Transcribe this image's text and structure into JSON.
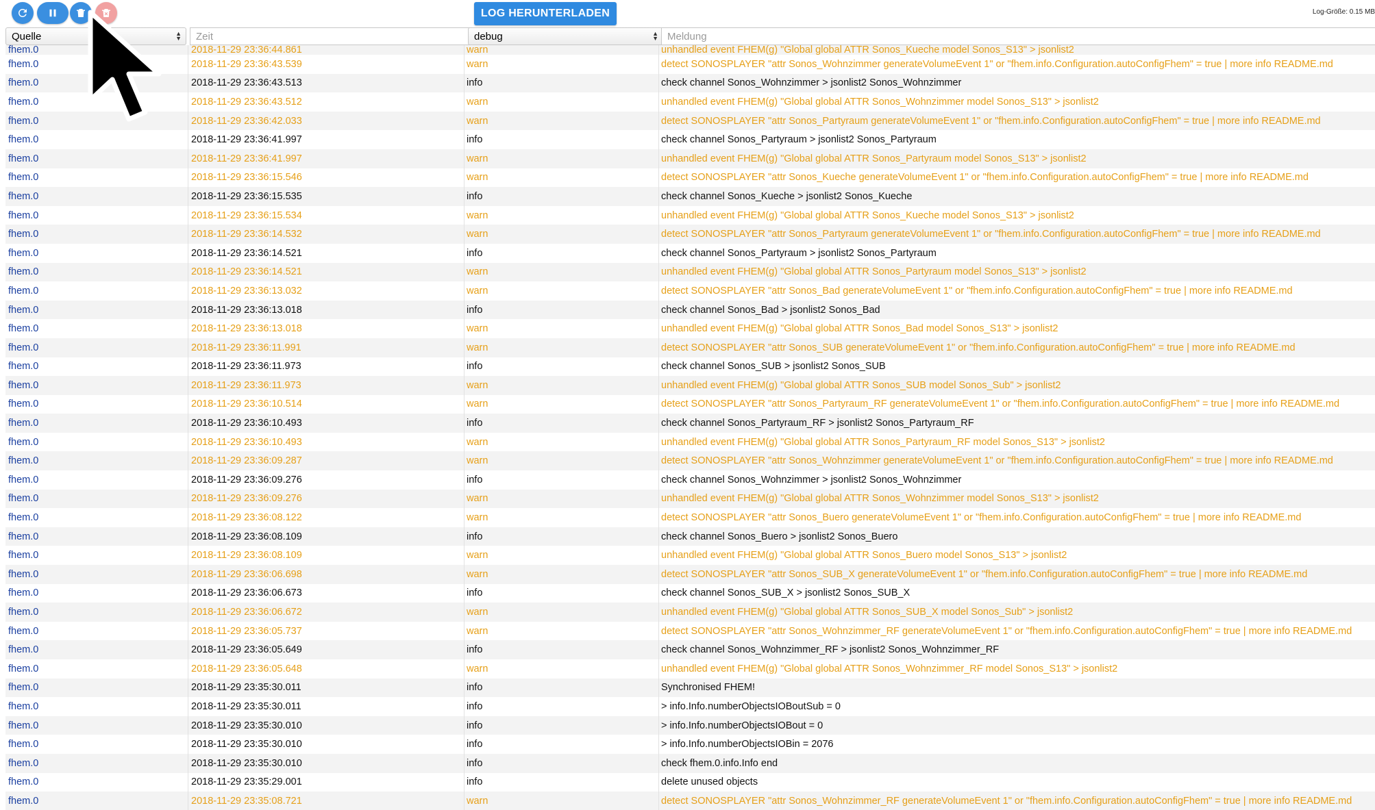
{
  "toolbar": {
    "buttons": [
      {
        "name": "refresh-button",
        "icon": "refresh-icon"
      },
      {
        "name": "pause-button",
        "icon": "pause-icon"
      },
      {
        "name": "clear-button",
        "icon": "trash-icon"
      },
      {
        "name": "delete-button",
        "icon": "delete-icon"
      }
    ],
    "download_label": "LOG HERUNTERLADEN",
    "logsize": "Log-Größe: 0.15 MB"
  },
  "filters": {
    "source": "Quelle",
    "time_placeholder": "Zeit",
    "severity": "debug",
    "message_placeholder": "Meldung"
  },
  "colors": {
    "accent": "#2f8ae0",
    "warn": "#e6a019",
    "source": "#1a3fa0",
    "disabled": "#f1a1a1"
  },
  "top_partial": {
    "source": "fhem.0",
    "time": "2018-11-29 23:36:44.861",
    "severity": "warn",
    "message": "unhandled event FHEM(g) \"Global global ATTR Sonos_Kueche model Sonos_S13\" > jsonlist2"
  },
  "rows": [
    {
      "source": "fhem.0",
      "time": "2018-11-29 23:36:43.539",
      "severity": "warn",
      "message": "detect SONOSPLAYER \"attr Sonos_Wohnzimmer generateVolumeEvent 1\" or \"fhem.info.Configuration.autoConfigFhem\" = true | more info README.md"
    },
    {
      "source": "fhem.0",
      "time": "2018-11-29 23:36:43.513",
      "severity": "info",
      "message": "check channel Sonos_Wohnzimmer > jsonlist2 Sonos_Wohnzimmer"
    },
    {
      "source": "fhem.0",
      "time": "2018-11-29 23:36:43.512",
      "severity": "warn",
      "message": "unhandled event FHEM(g) \"Global global ATTR Sonos_Wohnzimmer model Sonos_S13\" > jsonlist2"
    },
    {
      "source": "fhem.0",
      "time": "2018-11-29 23:36:42.033",
      "severity": "warn",
      "message": "detect SONOSPLAYER \"attr Sonos_Partyraum generateVolumeEvent 1\" or \"fhem.info.Configuration.autoConfigFhem\" = true | more info README.md"
    },
    {
      "source": "fhem.0",
      "time": "2018-11-29 23:36:41.997",
      "severity": "info",
      "message": "check channel Sonos_Partyraum > jsonlist2 Sonos_Partyraum"
    },
    {
      "source": "fhem.0",
      "time": "2018-11-29 23:36:41.997",
      "severity": "warn",
      "message": "unhandled event FHEM(g) \"Global global ATTR Sonos_Partyraum model Sonos_S13\" > jsonlist2"
    },
    {
      "source": "fhem.0",
      "time": "2018-11-29 23:36:15.546",
      "severity": "warn",
      "message": "detect SONOSPLAYER \"attr Sonos_Kueche generateVolumeEvent 1\" or \"fhem.info.Configuration.autoConfigFhem\" = true | more info README.md"
    },
    {
      "source": "fhem.0",
      "time": "2018-11-29 23:36:15.535",
      "severity": "info",
      "message": "check channel Sonos_Kueche > jsonlist2 Sonos_Kueche"
    },
    {
      "source": "fhem.0",
      "time": "2018-11-29 23:36:15.534",
      "severity": "warn",
      "message": "unhandled event FHEM(g) \"Global global ATTR Sonos_Kueche model Sonos_S13\" > jsonlist2"
    },
    {
      "source": "fhem.0",
      "time": "2018-11-29 23:36:14.532",
      "severity": "warn",
      "message": "detect SONOSPLAYER \"attr Sonos_Partyraum generateVolumeEvent 1\" or \"fhem.info.Configuration.autoConfigFhem\" = true | more info README.md"
    },
    {
      "source": "fhem.0",
      "time": "2018-11-29 23:36:14.521",
      "severity": "info",
      "message": "check channel Sonos_Partyraum > jsonlist2 Sonos_Partyraum"
    },
    {
      "source": "fhem.0",
      "time": "2018-11-29 23:36:14.521",
      "severity": "warn",
      "message": "unhandled event FHEM(g) \"Global global ATTR Sonos_Partyraum model Sonos_S13\" > jsonlist2"
    },
    {
      "source": "fhem.0",
      "time": "2018-11-29 23:36:13.032",
      "severity": "warn",
      "message": "detect SONOSPLAYER \"attr Sonos_Bad generateVolumeEvent 1\" or \"fhem.info.Configuration.autoConfigFhem\" = true | more info README.md"
    },
    {
      "source": "fhem.0",
      "time": "2018-11-29 23:36:13.018",
      "severity": "info",
      "message": "check channel Sonos_Bad > jsonlist2 Sonos_Bad"
    },
    {
      "source": "fhem.0",
      "time": "2018-11-29 23:36:13.018",
      "severity": "warn",
      "message": "unhandled event FHEM(g) \"Global global ATTR Sonos_Bad model Sonos_S13\" > jsonlist2"
    },
    {
      "source": "fhem.0",
      "time": "2018-11-29 23:36:11.991",
      "severity": "warn",
      "message": "detect SONOSPLAYER \"attr Sonos_SUB generateVolumeEvent 1\" or \"fhem.info.Configuration.autoConfigFhem\" = true | more info README.md"
    },
    {
      "source": "fhem.0",
      "time": "2018-11-29 23:36:11.973",
      "severity": "info",
      "message": "check channel Sonos_SUB > jsonlist2 Sonos_SUB"
    },
    {
      "source": "fhem.0",
      "time": "2018-11-29 23:36:11.973",
      "severity": "warn",
      "message": "unhandled event FHEM(g) \"Global global ATTR Sonos_SUB model Sonos_Sub\" > jsonlist2"
    },
    {
      "source": "fhem.0",
      "time": "2018-11-29 23:36:10.514",
      "severity": "warn",
      "message": "detect SONOSPLAYER \"attr Sonos_Partyraum_RF generateVolumeEvent 1\" or \"fhem.info.Configuration.autoConfigFhem\" = true | more info README.md"
    },
    {
      "source": "fhem.0",
      "time": "2018-11-29 23:36:10.493",
      "severity": "info",
      "message": "check channel Sonos_Partyraum_RF > jsonlist2 Sonos_Partyraum_RF"
    },
    {
      "source": "fhem.0",
      "time": "2018-11-29 23:36:10.493",
      "severity": "warn",
      "message": "unhandled event FHEM(g) \"Global global ATTR Sonos_Partyraum_RF model Sonos_S13\" > jsonlist2"
    },
    {
      "source": "fhem.0",
      "time": "2018-11-29 23:36:09.287",
      "severity": "warn",
      "message": "detect SONOSPLAYER \"attr Sonos_Wohnzimmer generateVolumeEvent 1\" or \"fhem.info.Configuration.autoConfigFhem\" = true | more info README.md"
    },
    {
      "source": "fhem.0",
      "time": "2018-11-29 23:36:09.276",
      "severity": "info",
      "message": "check channel Sonos_Wohnzimmer > jsonlist2 Sonos_Wohnzimmer"
    },
    {
      "source": "fhem.0",
      "time": "2018-11-29 23:36:09.276",
      "severity": "warn",
      "message": "unhandled event FHEM(g) \"Global global ATTR Sonos_Wohnzimmer model Sonos_S13\" > jsonlist2"
    },
    {
      "source": "fhem.0",
      "time": "2018-11-29 23:36:08.122",
      "severity": "warn",
      "message": "detect SONOSPLAYER \"attr Sonos_Buero generateVolumeEvent 1\" or \"fhem.info.Configuration.autoConfigFhem\" = true | more info README.md"
    },
    {
      "source": "fhem.0",
      "time": "2018-11-29 23:36:08.109",
      "severity": "info",
      "message": "check channel Sonos_Buero > jsonlist2 Sonos_Buero"
    },
    {
      "source": "fhem.0",
      "time": "2018-11-29 23:36:08.109",
      "severity": "warn",
      "message": "unhandled event FHEM(g) \"Global global ATTR Sonos_Buero model Sonos_S13\" > jsonlist2"
    },
    {
      "source": "fhem.0",
      "time": "2018-11-29 23:36:06.698",
      "severity": "warn",
      "message": "detect SONOSPLAYER \"attr Sonos_SUB_X generateVolumeEvent 1\" or \"fhem.info.Configuration.autoConfigFhem\" = true | more info README.md"
    },
    {
      "source": "fhem.0",
      "time": "2018-11-29 23:36:06.673",
      "severity": "info",
      "message": "check channel Sonos_SUB_X > jsonlist2 Sonos_SUB_X"
    },
    {
      "source": "fhem.0",
      "time": "2018-11-29 23:36:06.672",
      "severity": "warn",
      "message": "unhandled event FHEM(g) \"Global global ATTR Sonos_SUB_X model Sonos_Sub\" > jsonlist2"
    },
    {
      "source": "fhem.0",
      "time": "2018-11-29 23:36:05.737",
      "severity": "warn",
      "message": "detect SONOSPLAYER \"attr Sonos_Wohnzimmer_RF generateVolumeEvent 1\" or \"fhem.info.Configuration.autoConfigFhem\" = true | more info README.md"
    },
    {
      "source": "fhem.0",
      "time": "2018-11-29 23:36:05.649",
      "severity": "info",
      "message": "check channel Sonos_Wohnzimmer_RF > jsonlist2 Sonos_Wohnzimmer_RF"
    },
    {
      "source": "fhem.0",
      "time": "2018-11-29 23:36:05.648",
      "severity": "warn",
      "message": "unhandled event FHEM(g) \"Global global ATTR Sonos_Wohnzimmer_RF model Sonos_S13\" > jsonlist2"
    },
    {
      "source": "fhem.0",
      "time": "2018-11-29 23:35:30.011",
      "severity": "info",
      "message": "Synchronised FHEM!"
    },
    {
      "source": "fhem.0",
      "time": "2018-11-29 23:35:30.011",
      "severity": "info",
      "message": "> info.Info.numberObjectsIOBoutSub = 0"
    },
    {
      "source": "fhem.0",
      "time": "2018-11-29 23:35:30.010",
      "severity": "info",
      "message": "> info.Info.numberObjectsIOBout = 0"
    },
    {
      "source": "fhem.0",
      "time": "2018-11-29 23:35:30.010",
      "severity": "info",
      "message": "> info.Info.numberObjectsIOBin = 2076"
    },
    {
      "source": "fhem.0",
      "time": "2018-11-29 23:35:30.010",
      "severity": "info",
      "message": "check fhem.0.info.Info end"
    },
    {
      "source": "fhem.0",
      "time": "2018-11-29 23:35:29.001",
      "severity": "info",
      "message": "delete unused objects"
    },
    {
      "source": "fhem.0",
      "time": "2018-11-29 23:35:08.721",
      "severity": "warn",
      "message": "detect SONOSPLAYER \"attr Sonos_Wohnzimmer_RF generateVolumeEvent 1\" or \"fhem.info.Configuration.autoConfigFhem\" = true | more info README.md"
    }
  ]
}
